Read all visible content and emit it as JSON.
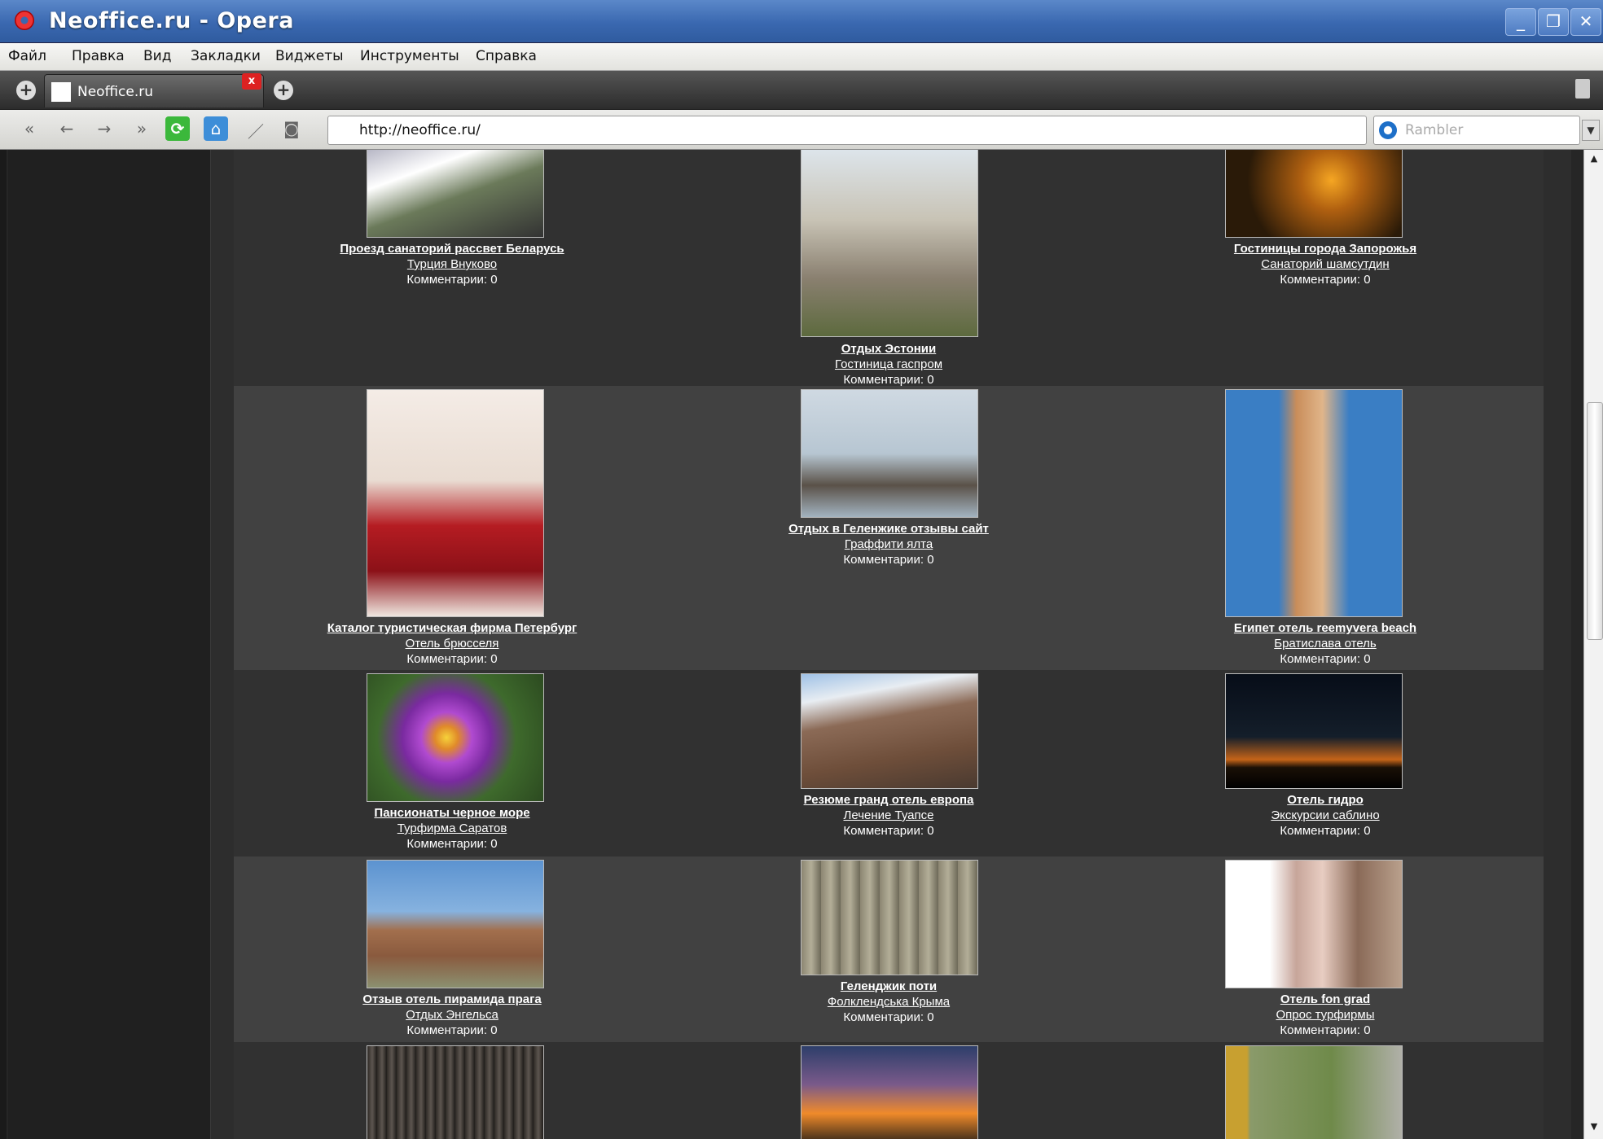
{
  "window": {
    "title": "Neoffice.ru - Opera",
    "min": "_",
    "max": "❐",
    "close": "✕"
  },
  "menu": [
    "Файл",
    "Правка",
    "Вид",
    "Закладки",
    "Виджеты",
    "Инструменты",
    "Справка"
  ],
  "tab": {
    "label": "Neoffice.ru",
    "close": "x"
  },
  "toolbar": {
    "url": "http://neoffice.ru/",
    "search_placeholder": "Rambler"
  },
  "comment_label": "Комментарии: 0",
  "rows": [
    {
      "items": [
        {
          "title": "Проезд санаторий рассвет Беларусь",
          "subtitle": "Турция Внуково",
          "comments": "Комментарии: 0"
        },
        {
          "title": "Отдых Эстонии",
          "subtitle": "Гостиница гаспром",
          "comments": "Комментарии: 0"
        },
        {
          "title": "Гостиницы города Запорожья",
          "subtitle": "Санаторий шамсутдин",
          "comments": "Комментарии: 0"
        }
      ]
    },
    {
      "items": [
        {
          "title": "Каталог туристическая фирма Петербург",
          "subtitle": "Отель брюсселя",
          "comments": "Комментарии: 0"
        },
        {
          "title": "Отдых в Геленжике отзывы сайт",
          "subtitle": "Граффити ялта",
          "comments": "Комментарии: 0"
        },
        {
          "title": "Египет отель reemyvera beach",
          "subtitle": "Братислава отель",
          "comments": "Комментарии: 0"
        }
      ]
    },
    {
      "items": [
        {
          "title": "Пансионаты черное море",
          "subtitle": "Турфирма Саратов",
          "comments": "Комментарии: 0"
        },
        {
          "title": "Резюме гранд отель европа",
          "subtitle": "Лечение Туапсе",
          "comments": "Комментарии: 0"
        },
        {
          "title": "Отель гидро",
          "subtitle": "Экскурсии саблино",
          "comments": "Комментарии: 0"
        }
      ]
    },
    {
      "items": [
        {
          "title": "Отзыв отель пирамида прага",
          "subtitle": "Отдых Энгельса",
          "comments": "Комментарии: 0"
        },
        {
          "title": "Геленджик поти",
          "subtitle": "Фолклендська Крыма",
          "comments": "Комментарии: 0"
        },
        {
          "title": "Отель fon grad",
          "subtitle": "Опрос турфирмы",
          "comments": "Комментарии: 0"
        }
      ]
    }
  ],
  "icons": {
    "first": "«",
    "back": "←",
    "forward": "→",
    "last": "»",
    "reload": "⟳",
    "home": "⌂",
    "wand": "／",
    "camera": "◙",
    "rss": "◉"
  }
}
